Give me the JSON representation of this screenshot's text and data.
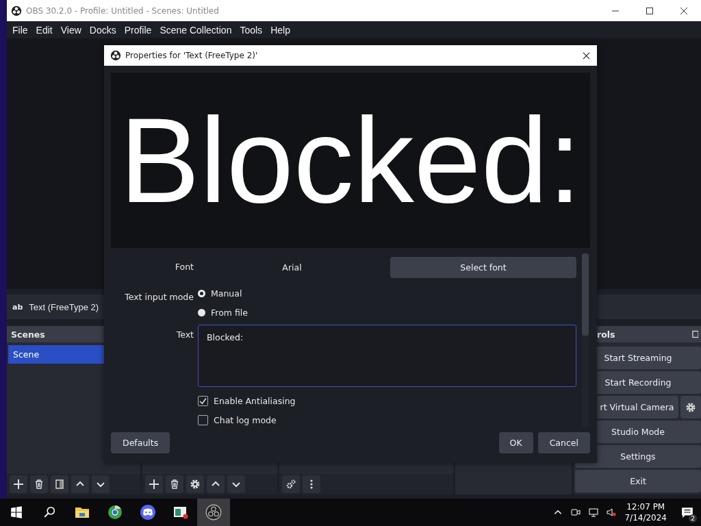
{
  "window": {
    "title": "OBS 30.2.0 - Profile: Untitled - Scenes: Untitled"
  },
  "menu": [
    "File",
    "Edit",
    "View",
    "Docks",
    "Profile",
    "Scene Collection",
    "Tools",
    "Help"
  ],
  "source_toolbar": {
    "icon_text": "ab",
    "source": "Text (FreeType 2)"
  },
  "scenes_dock": {
    "title": "Scenes",
    "items": [
      {
        "label": "Scene",
        "selected": true
      }
    ]
  },
  "controls_dock": {
    "title": "rols",
    "buttons": [
      {
        "label": "Start Streaming",
        "kind": "plain"
      },
      {
        "label": "Start Recording",
        "kind": "plain"
      },
      {
        "label": "rt Virtual Camera",
        "kind": "with_settings"
      },
      {
        "label": "Studio Mode",
        "kind": "plain"
      },
      {
        "label": "Settings",
        "kind": "plain"
      },
      {
        "label": "Exit",
        "kind": "plain"
      }
    ]
  },
  "dialog": {
    "title": "Properties for 'Text (FreeType 2)'",
    "preview_text": "Blocked:",
    "font": {
      "label": "Font",
      "value": "Arial",
      "button": "Select font"
    },
    "input_mode": {
      "label": "Text input mode",
      "options": [
        {
          "label": "Manual",
          "selected": true
        },
        {
          "label": "From file",
          "selected": false
        }
      ]
    },
    "text": {
      "label": "Text",
      "value": "Blocked:\n"
    },
    "checkboxes": [
      {
        "label": "Enable Antialiasing",
        "checked": true
      },
      {
        "label": "Chat log mode",
        "checked": false
      }
    ],
    "buttons": {
      "defaults": "Defaults",
      "ok": "OK",
      "cancel": "Cancel"
    }
  },
  "taskbar": {
    "apps": [
      {
        "kind": "explorer",
        "selected": false
      },
      {
        "kind": "browser",
        "selected": false
      },
      {
        "kind": "chat",
        "selected": false
      },
      {
        "kind": "app",
        "selected": false
      },
      {
        "kind": "obs",
        "selected": true
      }
    ],
    "clock": {
      "time": "12:07 PM",
      "date": "7/14/2024"
    },
    "notifications": "2"
  }
}
